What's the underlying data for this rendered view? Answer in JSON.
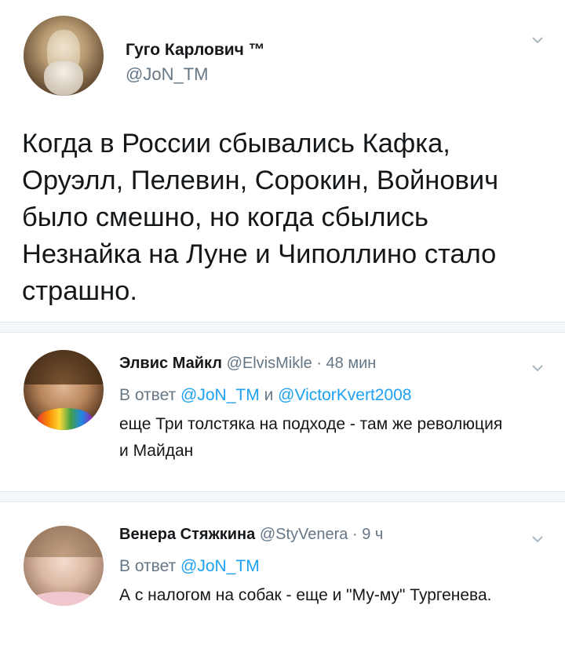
{
  "main_tweet": {
    "author_name": "Гуго Карлович ™",
    "author_handle": "@JoN_TM",
    "text": "Когда в России сбывались Кафка, Оруэлл, Пелевин, Сорокин, Войнович было смешно, но когда сбылись Незнайка на Луне и Чиполлино стало страшно."
  },
  "replies": [
    {
      "author_name": "Элвис Майкл",
      "author_handle": "@ElvisMikle",
      "time": "· 48 мин",
      "reply_prefix": "В ответ",
      "reply_to_1": "@JoN_TM",
      "reply_joiner": "и",
      "reply_to_2": "@VictorKvert2008",
      "text": "еще Три толстяка на подходе - там же революция и Майдан"
    },
    {
      "author_name": "Венера Стяжкина",
      "author_handle": "@StyVenera",
      "time": "· 9 ч",
      "reply_prefix": "В ответ",
      "reply_to_1": "@JoN_TM",
      "text": "А с налогом на собак - еще и \"Му-му\" Тургенева."
    }
  ],
  "colors": {
    "link": "#1da1f2",
    "secondary_text": "#657786",
    "divider": "#e1e8ed",
    "gap": "#f5f8fa"
  },
  "icons": {
    "menu_chevron": "chevron-down-icon"
  }
}
